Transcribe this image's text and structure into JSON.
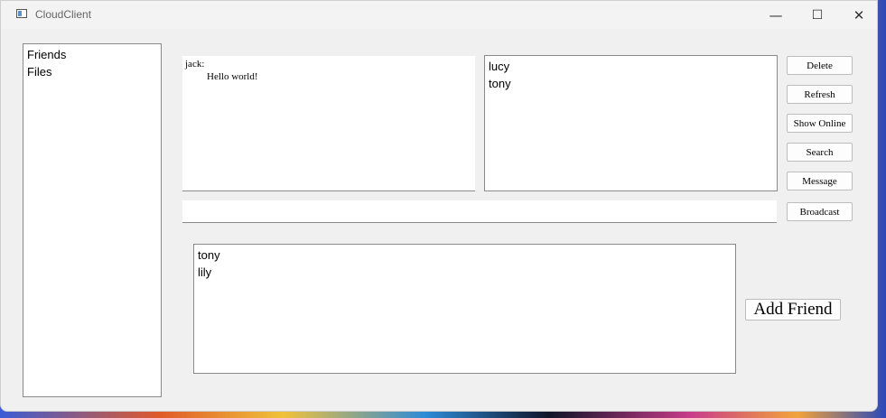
{
  "window": {
    "title": "CloudClient"
  },
  "titlebar": {
    "minimize": "—",
    "maximize": "☐",
    "close": "✕"
  },
  "nav": {
    "items": [
      "Friends",
      "Files"
    ]
  },
  "chat": {
    "from": "jack:",
    "message": "Hello world!"
  },
  "online_list": {
    "items": [
      "lucy",
      "tony"
    ]
  },
  "actions": {
    "delete": "Delete",
    "refresh": "Refresh",
    "show_online": "Show Online",
    "search": "Search",
    "message": "Message",
    "broadcast": "Broadcast"
  },
  "message_input": {
    "value": ""
  },
  "search_results": {
    "items": [
      "tony",
      "lily"
    ]
  },
  "add_friend": {
    "label": "Add Friend"
  }
}
